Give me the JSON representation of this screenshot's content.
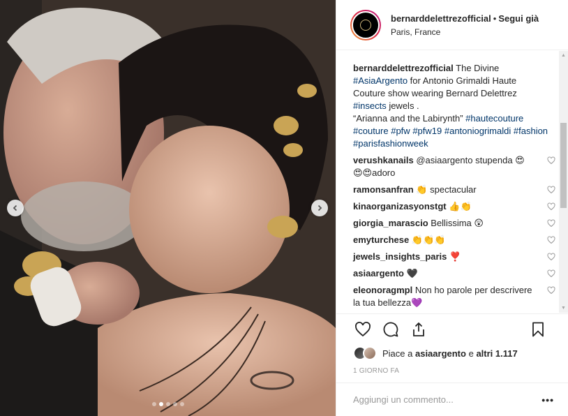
{
  "header": {
    "username": "bernarddelettrezofficial",
    "separator": "•",
    "follow_label": "Segui già",
    "location": "Paris, France"
  },
  "caption": {
    "username": "bernarddelettrezofficial",
    "t1": " The Divine ",
    "tag1": "#AsiaArgento",
    "t2": " for Antonio Grimaldi Haute Couture show wearing Bernard Delettrez ",
    "tag2": "#insects",
    "t3": " jewels .",
    "t4": "“Arianna and the Labirynth” ",
    "tag3": "#hautecouture",
    "tag4": "#couture",
    "tag5": "#pfw",
    "tag6": "#pfw19",
    "tag7": "#antoniogrimaldi",
    "tag8": "#fashion",
    "tag9": "#parisfashionweek"
  },
  "comments": [
    {
      "username": "verushkanails",
      "text": " @asiaargento stupenda 😍😍😍adoro"
    },
    {
      "username": "ramonsanfran",
      "text": " 👏 spectacular"
    },
    {
      "username": "kinaorganizasyonstgt",
      "text": " 👍👏"
    },
    {
      "username": "giorgia_marascio",
      "text": " Bellissima 😲"
    },
    {
      "username": "emyturchese",
      "text": " 👏👏👏"
    },
    {
      "username": "jewels_insights_paris",
      "text": " ❣️"
    },
    {
      "username": "asiaargento",
      "text": " 🖤"
    },
    {
      "username": "eleonoragmpl",
      "text": " Non ho parole per descrivere la tua bellezza💜"
    }
  ],
  "likes": {
    "prefix": "Piace a ",
    "user": "asiaargento",
    "mid": " e ",
    "others": "altri 1.117"
  },
  "time_ago": "1 GIORNO FA",
  "add_comment": {
    "placeholder": "Aggiungi un commento...",
    "more": "•••"
  },
  "carousel": {
    "total": 5,
    "active": 1
  }
}
